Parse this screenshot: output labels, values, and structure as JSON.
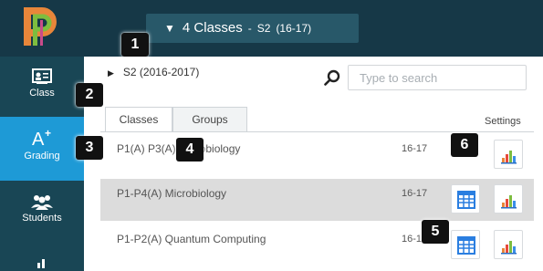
{
  "header": {
    "class_selector": {
      "caret": "▼",
      "label": "4 Classes",
      "separator": "-",
      "term": "S2",
      "years": "(16-17)"
    }
  },
  "sidebar": {
    "items": [
      {
        "label": "Class",
        "icon": "class-icon"
      },
      {
        "label": "Grading",
        "icon": "grading-icon"
      },
      {
        "label": "Students",
        "icon": "students-icon"
      },
      {
        "label": "",
        "icon": "reports-icon"
      }
    ]
  },
  "term_filter": {
    "caret": "▶",
    "label": "S2 (2016-2017)"
  },
  "search": {
    "placeholder": "Type to search",
    "value": ""
  },
  "tabs": [
    {
      "label": "Classes",
      "active": true
    },
    {
      "label": "Groups",
      "active": false
    }
  ],
  "settings_label": "Settings",
  "rows": [
    {
      "name": "P1(A) P3(A) Microbiology",
      "year": "16-17",
      "show_gradebook_icon": false,
      "highlighted": false
    },
    {
      "name": "P1-P4(A) Microbiology",
      "year": "16-17",
      "show_gradebook_icon": true,
      "highlighted": true
    },
    {
      "name": "P1-P2(A) Quantum Computing",
      "year": "16-17",
      "show_gradebook_icon": true,
      "highlighted": false
    }
  ],
  "callouts": [
    "1",
    "2",
    "3",
    "4",
    "5",
    "6"
  ],
  "colors": {
    "topbar": "#163847",
    "sidebar": "#194655",
    "grading_active": "#1e9ad6",
    "class_selector": "#285869",
    "row_highlight": "#dcdcdc",
    "logo_orange": "#e8863a",
    "logo_green": "#7dbd3f"
  }
}
